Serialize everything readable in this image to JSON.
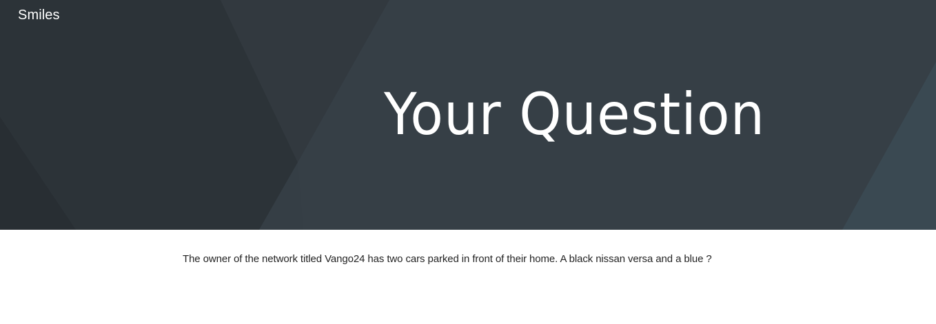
{
  "header": {
    "site_name": "Smiles",
    "title": "Your Question"
  },
  "main": {
    "question_text": "The owner of the network titled Vango24 has two cars parked in front of their home. A black nissan versa and a blue ?"
  },
  "colors": {
    "hero_background": "#343d44",
    "hero_dark_shape": "#2b3237",
    "hero_light_shape": "#3a434a",
    "hero_accent_shape": "#3b4a53",
    "text_light": "#ffffff",
    "text_dark": "#222222"
  }
}
